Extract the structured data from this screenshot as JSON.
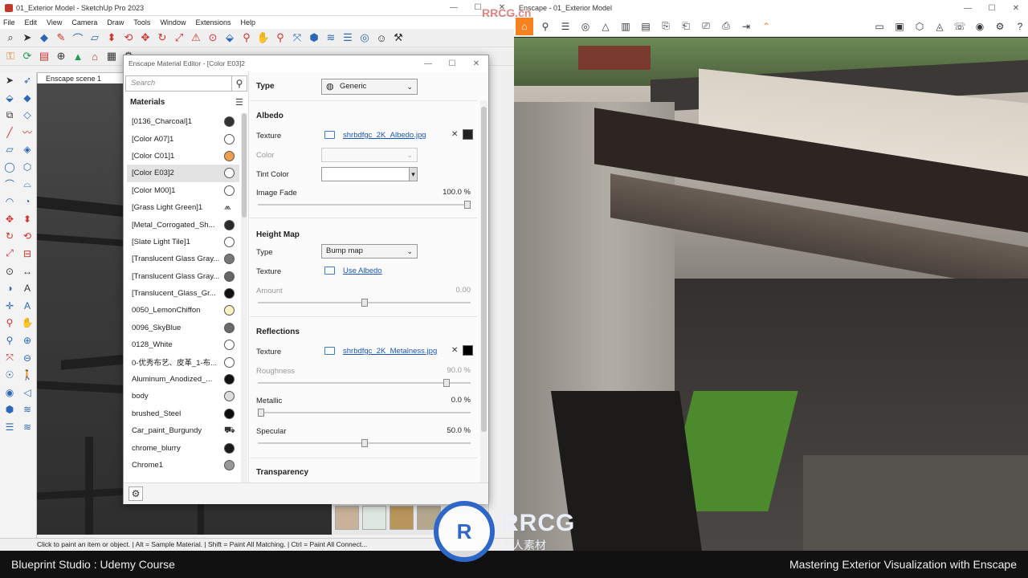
{
  "sketchup": {
    "title": "01_Exterior Model - SketchUp Pro 2023",
    "menu": [
      "File",
      "Edit",
      "View",
      "Camera",
      "Draw",
      "Tools",
      "Window",
      "Extensions",
      "Help"
    ],
    "scene_tab": "Enscape scene 1",
    "status_text": "Click to paint an item or object. | Alt = Sample Material. | Shift = Paint All Matching. | Ctrl = Paint All Connect..."
  },
  "material_editor": {
    "title": "Enscape Material Editor - [Color E03]2",
    "search_placeholder": "Search",
    "materials_heading": "Materials",
    "materials": [
      {
        "name": "[0136_Charcoal]1",
        "swatch": "#333333"
      },
      {
        "name": "[Color A07]1",
        "swatch": "#ffffff"
      },
      {
        "name": "[Color C01]1",
        "swatch": "#f0a04b"
      },
      {
        "name": "[Color E03]2",
        "swatch": "#ffffff",
        "selected": true
      },
      {
        "name": "[Color M00]1",
        "swatch": "#ffffff"
      },
      {
        "name": "[Grass Light Green]1",
        "swatch": "grass"
      },
      {
        "name": "[Metal_Corrogated_Sh...",
        "swatch": "#2a2a2a"
      },
      {
        "name": "[Slate Light Tile]1",
        "swatch": "#ffffff"
      },
      {
        "name": "[Translucent Glass Gray...",
        "swatch": "#777777"
      },
      {
        "name": "[Translucent Glass Gray...",
        "swatch": "#666666"
      },
      {
        "name": "[Translucent_Glass_Gr...",
        "swatch": "#111111"
      },
      {
        "name": "0050_LemonChiffon",
        "swatch": "#f7f1c2"
      },
      {
        "name": "0096_SkyBlue",
        "swatch": "#6a6a6a"
      },
      {
        "name": "0128_White",
        "swatch": "#ffffff"
      },
      {
        "name": "0-优秀布艺、皮革_1-布...",
        "swatch": "#ffffff"
      },
      {
        "name": "Aluminum_Anodized_...",
        "swatch": "#111111"
      },
      {
        "name": "body",
        "swatch": "#dddddd"
      },
      {
        "name": "brushed_Steel",
        "swatch": "#0d0d0d"
      },
      {
        "name": "Car_paint_Burgundy",
        "swatch": "car"
      },
      {
        "name": "chrome_blurry",
        "swatch": "#1a1a1a"
      },
      {
        "name": "Chrome1",
        "swatch": "#999999"
      }
    ],
    "type_label": "Type",
    "type_value": "Generic",
    "albedo": {
      "heading": "Albedo",
      "texture_label": "Texture",
      "texture_file": "shrbdfgc_2K_Albedo.jpg",
      "texture_swatch": "#222222",
      "color_label": "Color",
      "tint_label": "Tint Color",
      "fade_label": "Image Fade",
      "fade_value": "100.0 %",
      "fade_fraction": 1.0
    },
    "height_map": {
      "heading": "Height Map",
      "type_label": "Type",
      "type_value": "Bump map",
      "texture_label": "Texture",
      "texture_link": "Use Albedo",
      "amount_label": "Amount",
      "amount_value": "0.00",
      "amount_fraction": 0.5
    },
    "reflections": {
      "heading": "Reflections",
      "texture_label": "Texture",
      "texture_file": "shrbdfgc_2K_Metalness.jpg",
      "texture_swatch": "#000000",
      "roughness_label": "Roughness",
      "roughness_value": "90.0 %",
      "roughness_fraction": 0.9,
      "metallic_label": "Metallic",
      "metallic_value": "0.0 %",
      "metallic_fraction": 0.0,
      "specular_label": "Specular",
      "specular_value": "50.0 %",
      "specular_fraction": 0.5
    },
    "transparency_heading": "Transparency"
  },
  "enscape": {
    "title": "Enscape - 01_Exterior Model",
    "accent": "#f58220"
  },
  "banner": {
    "left": "Blueprint Studio : Udemy Course",
    "right": "Mastering Exterior Visualization with Enscape"
  },
  "watermark": {
    "logo_text": "RRCG",
    "sub_text": "人人素材",
    "top_text": "RRCG.cn"
  }
}
